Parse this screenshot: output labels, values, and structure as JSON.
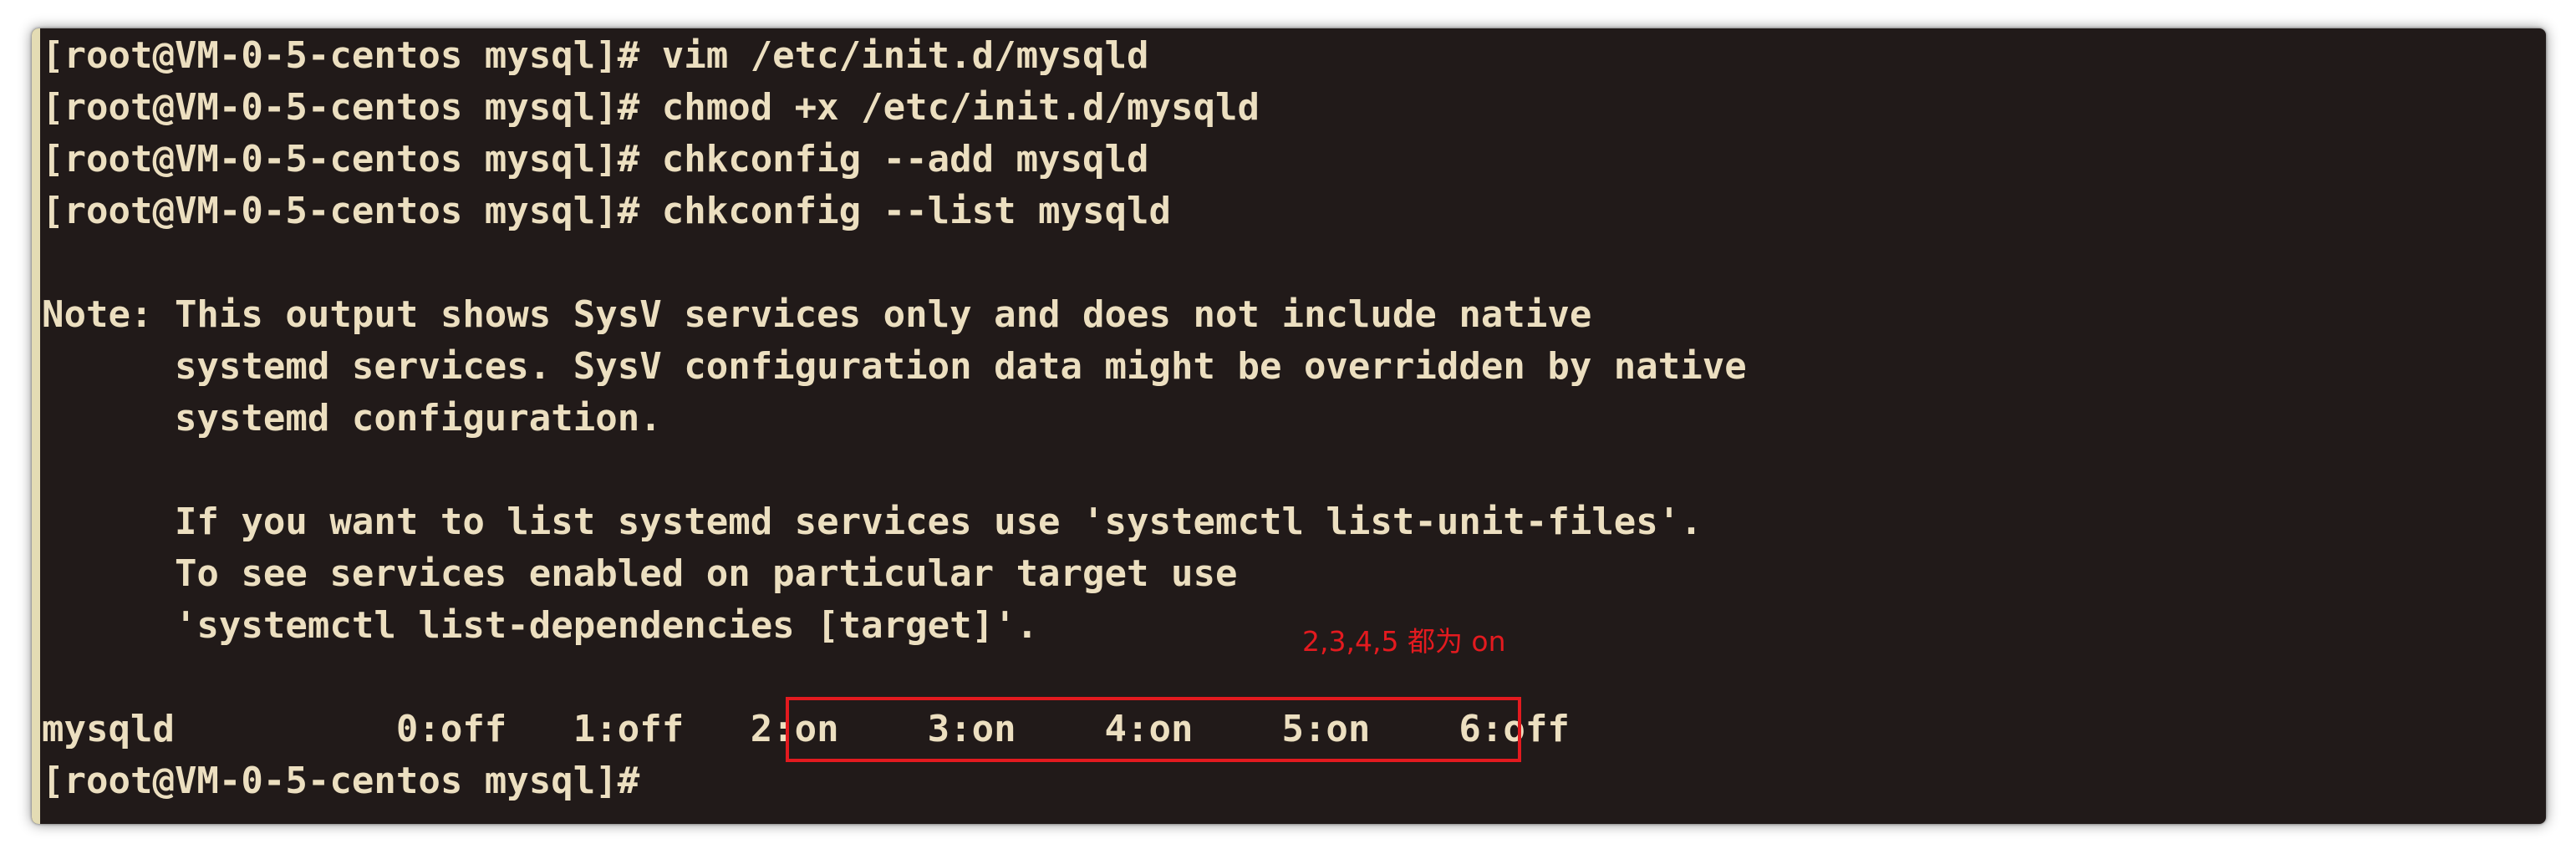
{
  "terminal": {
    "lines": [
      "[root@VM-0-5-centos mysql]# vim /etc/init.d/mysqld",
      "[root@VM-0-5-centos mysql]# chmod +x /etc/init.d/mysqld",
      "[root@VM-0-5-centos mysql]# chkconfig --add mysqld",
      "[root@VM-0-5-centos mysql]# chkconfig --list mysqld",
      "",
      "Note: This output shows SysV services only and does not include native",
      "      systemd services. SysV configuration data might be overridden by native",
      "      systemd configuration.",
      "",
      "      If you want to list systemd services use 'systemctl list-unit-files'.",
      "      To see services enabled on particular target use",
      "      'systemctl list-dependencies [target]'.",
      "",
      "mysqld          0:off   1:off   2:on    3:on    4:on    5:on    6:off",
      "[root@VM-0-5-centos mysql]#"
    ]
  },
  "annotation": {
    "label": "2,3,4,5 都为 on",
    "color": "#e31a1f"
  },
  "colors": {
    "terminal_bg": "#211a19",
    "terminal_fg": "#ecdfc0"
  }
}
